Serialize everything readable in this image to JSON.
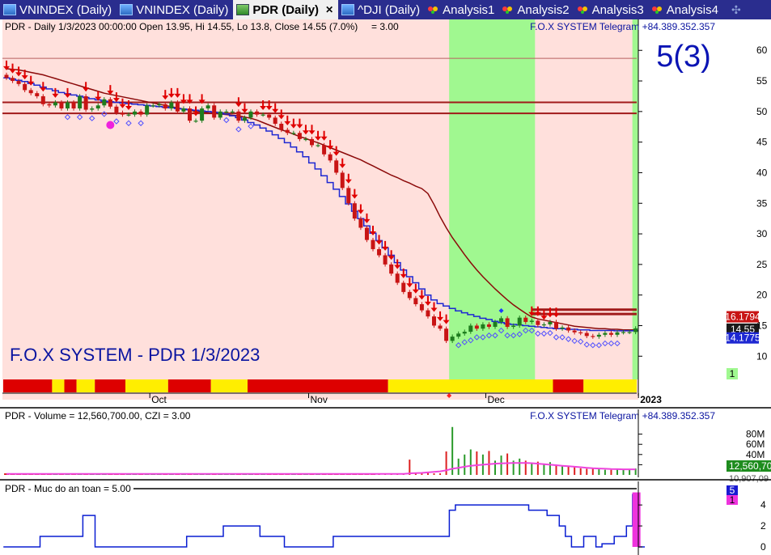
{
  "tabs": [
    {
      "label": "VNINDEX (Daily)",
      "kind": "chart",
      "active": false
    },
    {
      "label": "VNINDEX (Daily)",
      "kind": "chart",
      "active": false
    },
    {
      "label": "PDR (Daily)",
      "kind": "chart",
      "active": true
    },
    {
      "label": "^DJI (Daily)",
      "kind": "chart",
      "active": false
    },
    {
      "label": "Analysis1",
      "kind": "analysis",
      "active": false
    },
    {
      "label": "Analysis2",
      "kind": "analysis",
      "active": false
    },
    {
      "label": "Analysis3",
      "kind": "analysis",
      "active": false
    },
    {
      "label": "Analysis4",
      "kind": "analysis",
      "active": false
    }
  ],
  "tab_close_glyph": "✕",
  "tab_gear_glyph": "✣",
  "colors": {
    "bear_zone": "#ffe0dc",
    "bull_zone": "#a0f890",
    "up_candle": "#1e7d1e",
    "down_candle": "#c81414",
    "ma_fast": "#1e28d2",
    "ma_slow": "#8b0a0a",
    "signal_arrow": "#e00000",
    "volume_ma": "#ee44dd",
    "volume_ma2": "#33dd33",
    "czi": "#d81b1b",
    "safety_line": "#0a1ed2",
    "label_blue": "#0a14a0"
  },
  "chart_data": [
    {
      "type": "candlestick",
      "panel": "price",
      "header": {
        "title": "PDR - Daily 1/3/2023 00:00:00 Open 13.95, Hi 14.55, Lo 13.8, Close 14.55 (7.0%)",
        "extra": "= 3.00",
        "credit": "F.O.X SYSTEM Telegram +84.389.352.357"
      },
      "overlay_label": "F.O.X SYSTEM - PDR 1/3/2023",
      "big_label": "5(3)",
      "y_ticks": [
        10,
        15,
        20,
        25,
        30,
        35,
        40,
        45,
        50,
        55,
        60
      ],
      "ylim": [
        6.2,
        64.0
      ],
      "x_labels": [
        "Oct",
        "Nov",
        "Dec",
        "2023"
      ],
      "x_label_index": [
        24,
        50,
        79,
        104
      ],
      "last_price": "14.55",
      "price_badges": [
        "16.1794",
        "14.55",
        "14.1775"
      ],
      "badge_values": [
        16.18,
        14.55,
        14.18
      ],
      "signal_badge": "1",
      "horizontal_lines": [
        58.7,
        51.5,
        49.7,
        17.6,
        16.9
      ],
      "bull_zones": [
        [
          73,
          86
        ],
        [
          103,
          104
        ]
      ],
      "candles_open": [
        56,
        55.5,
        55,
        54.5,
        53.5,
        53,
        52.5,
        51.2,
        51,
        51.5,
        50.5,
        51.5,
        50.5,
        52.5,
        50.3,
        50.5,
        51,
        52,
        50.8,
        49.8,
        49.5,
        49.5,
        50,
        49.5,
        51,
        51,
        51.2,
        50.5,
        51.5,
        50,
        50.5,
        48.5,
        48.5,
        50.5,
        51,
        49,
        50,
        50,
        50,
        48.5,
        49,
        50,
        49.5,
        49.5,
        49,
        48,
        47,
        46.5,
        46.5,
        45.5,
        45.5,
        44.5,
        44.5,
        43,
        42,
        40,
        37.5,
        35,
        32.5,
        31,
        29,
        27.5,
        26.5,
        25,
        23.5,
        22,
        20.5,
        19.5,
        18.5,
        17.5,
        16.5,
        15,
        14.5,
        12.5,
        13.2,
        13.7,
        14,
        15,
        14.5,
        15.2,
        14.8,
        15.6,
        16.2,
        14.8,
        15,
        16.3,
        15.6,
        15.8,
        15.1,
        15.2,
        15.6,
        14.5,
        14.7,
        14.2,
        13.9,
        13.8,
        13.3,
        13.2,
        13.5,
        13.8,
        13.5,
        13.9,
        13.95,
        13.95
      ],
      "candles_close": [
        55.5,
        55,
        54.5,
        53.5,
        53,
        52.5,
        51.2,
        51,
        51.5,
        50.5,
        51.5,
        50.5,
        52.5,
        50.3,
        50.5,
        51,
        52,
        50.8,
        49.8,
        49.5,
        49.5,
        50,
        49.5,
        51,
        51,
        51.2,
        50.5,
        51.5,
        50,
        50.5,
        48.5,
        48.5,
        50.5,
        51,
        49,
        50,
        50,
        50,
        48.5,
        49,
        50,
        49.5,
        49.5,
        49,
        48,
        47,
        46.5,
        46.5,
        45.5,
        45.5,
        44.5,
        44.5,
        43,
        42,
        40,
        37.5,
        35,
        32.5,
        31,
        29,
        27.5,
        26.5,
        25,
        23.5,
        22,
        20.5,
        19.5,
        18.5,
        17.5,
        16.5,
        15,
        14.5,
        12.5,
        13.2,
        13.7,
        14,
        15,
        14.5,
        15.2,
        14.8,
        15.6,
        16.2,
        14.8,
        15,
        16.3,
        15.6,
        15.8,
        15.1,
        15.2,
        15.6,
        14.5,
        14.7,
        14.2,
        13.9,
        13.8,
        13.3,
        13.2,
        13.5,
        13.8,
        13.5,
        13.9,
        13.95,
        13.95,
        14.55
      ],
      "ma_fast": [
        55.5,
        55.3,
        55.1,
        54.9,
        54.6,
        54.3,
        54,
        53.7,
        53.4,
        53.1,
        52.9,
        52.7,
        52.5,
        52.3,
        52.1,
        51.9,
        51.7,
        51.6,
        51.5,
        51.4,
        51.3,
        51.2,
        51.1,
        51,
        50.9,
        50.8,
        50.7,
        50.6,
        50.5,
        50.4,
        50.3,
        50.2,
        50.1,
        50,
        49.9,
        49.8,
        49.6,
        49.3,
        49,
        48.6,
        48.2,
        47.8,
        47.3,
        46.8,
        46.2,
        45.6,
        44.9,
        44.2,
        43.4,
        42.6,
        41.6,
        40.6,
        39.5,
        38.4,
        37.3,
        36.1,
        34.9,
        33.7,
        32.5,
        31.3,
        30.1,
        28.9,
        27.7,
        26.5,
        25.3,
        24.1,
        23,
        22,
        21,
        20,
        19.2,
        18.6,
        18.2,
        17.8,
        17.4,
        17.1,
        16.8,
        16.5,
        16.2,
        16,
        15.7,
        15.5,
        15.3,
        15.2,
        15.1,
        15,
        14.9,
        14.8,
        14.7,
        14.6,
        14.5,
        14.5,
        14.4,
        14.4,
        14.3,
        14.3,
        14.2,
        14.2,
        14.2,
        14.2,
        14.15,
        14.15,
        14.15,
        14.18
      ],
      "ma_slow": [
        57,
        56.9,
        56.8,
        56.6,
        56.4,
        56.2,
        56,
        55.7,
        55.4,
        55.1,
        54.8,
        54.5,
        54.2,
        53.9,
        53.6,
        53.3,
        53,
        52.8,
        52.6,
        52.4,
        52.2,
        52,
        51.8,
        51.6,
        51.4,
        51.2,
        51,
        50.8,
        50.6,
        50.4,
        50.2,
        50,
        49.9,
        49.8,
        49.7,
        49.6,
        49.5,
        49.4,
        49.3,
        49.1,
        48.9,
        48.6,
        48.2,
        47.8,
        47.4,
        47,
        46.7,
        46.3,
        45.9,
        45.6,
        45.2,
        44.9,
        44.5,
        44.1,
        43.7,
        43.3,
        42.9,
        42.5,
        42.1,
        41.6,
        41.1,
        40.6,
        40.1,
        39.6,
        39.2,
        38.7,
        38.3,
        37.8,
        37.4,
        36.6,
        34.8,
        32.8,
        31,
        29.4,
        28,
        26.6,
        25.3,
        24.1,
        23,
        22,
        21,
        20.1,
        19.2,
        18.4,
        17.7,
        17,
        16.4,
        16.1,
        15.9,
        15.7,
        15.5,
        15.3,
        15.1,
        14.9,
        14.8,
        14.7,
        14.6,
        14.5,
        14.5,
        14.4,
        14.4,
        14.3,
        14.3,
        14.3
      ],
      "sell_arrows": [
        0,
        1,
        2,
        3,
        4,
        6,
        8,
        10,
        13,
        15,
        17,
        18,
        19,
        20,
        26,
        27,
        28,
        29,
        30,
        31,
        32,
        38,
        39,
        42,
        43,
        44,
        45,
        46,
        47,
        48,
        49,
        50,
        51,
        52,
        53,
        54,
        55,
        56,
        57,
        58,
        59,
        60,
        61,
        62,
        63,
        64,
        65,
        66,
        67,
        68,
        69,
        70,
        71,
        72,
        86,
        87,
        88,
        89,
        90
      ]
    },
    {
      "type": "bar",
      "panel": "volume",
      "header": {
        "name": "PDR - Volume = 12,560,700.00, CZI = 3.00",
        "credit": "F.O.X SYSTEM Telegram +84.389.352.357"
      },
      "y_ticks": [
        "80M",
        "60M",
        "40M",
        "20M"
      ],
      "y_tick_values": [
        80,
        60,
        40,
        20
      ],
      "ylim": [
        0,
        100
      ],
      "last_label": "12,560,70",
      "ma_label": "10,907,09",
      "volume_m": [
        3,
        3,
        3,
        2,
        3,
        3,
        3,
        2,
        2,
        3,
        3,
        2,
        3,
        3,
        2,
        2,
        3,
        3,
        3,
        2,
        2,
        2,
        3,
        2,
        3,
        2,
        3,
        2,
        3,
        3,
        3,
        2,
        2,
        3,
        3,
        2,
        3,
        3,
        3,
        2,
        3,
        3,
        3,
        2,
        3,
        3,
        3,
        3,
        3,
        3,
        3,
        3,
        3,
        3,
        3,
        3,
        3,
        3,
        3,
        3,
        3,
        3,
        3,
        3,
        3,
        3,
        30,
        3,
        3,
        4,
        3,
        3,
        46,
        94,
        32,
        40,
        50,
        46,
        40,
        47,
        28,
        38,
        42,
        28,
        32,
        28,
        22,
        26,
        20,
        25,
        20,
        18,
        16,
        15,
        13,
        12,
        12,
        11,
        10,
        10,
        11,
        11,
        10,
        12.56
      ],
      "volume_ma_m": [
        2,
        2,
        2,
        2,
        2,
        2,
        2,
        2,
        2,
        2,
        2,
        2,
        2,
        2,
        2,
        2,
        2,
        2,
        2,
        2,
        2,
        2,
        2,
        2,
        2,
        2,
        2,
        2,
        2,
        2,
        2,
        2,
        2,
        2,
        2,
        2,
        2,
        2,
        2,
        2,
        2,
        2,
        2,
        2,
        2,
        2,
        2,
        2,
        2,
        2,
        2,
        2,
        2,
        2,
        2,
        2,
        2,
        2,
        2,
        2,
        2,
        2,
        2,
        2,
        2,
        2,
        3,
        3.5,
        4,
        5,
        6,
        7,
        9,
        12,
        14,
        16,
        18,
        19,
        20,
        21,
        22,
        22.5,
        23,
        23.5,
        23.5,
        23.3,
        23,
        22,
        21,
        20,
        19,
        18,
        17,
        16,
        15,
        14,
        13,
        12.5,
        12,
        11.5,
        11.2,
        11,
        11,
        10.9
      ]
    },
    {
      "type": "line",
      "panel": "safety",
      "header": {
        "name": "PDR - Muc do an toan = 5.00"
      },
      "y_ticks": [
        "4",
        "2",
        "0"
      ],
      "y_tick_values": [
        4,
        2,
        0
      ],
      "ylim": [
        0,
        5.4
      ],
      "current_badge": "5",
      "sub_badge": "1",
      "levels": [
        0,
        0,
        0,
        0,
        0,
        0,
        1,
        1,
        1,
        1,
        1,
        1,
        1,
        3,
        3,
        0,
        0,
        0,
        0,
        0,
        0,
        0,
        0,
        0,
        0,
        0,
        0,
        0,
        0,
        0,
        1,
        1,
        1,
        1,
        1,
        1,
        2,
        2,
        2,
        2,
        2,
        2,
        1,
        1,
        1,
        1,
        0,
        0,
        0,
        0,
        0,
        0,
        0,
        0,
        1,
        1,
        1,
        1,
        1,
        1,
        1,
        1,
        1,
        1,
        1,
        1,
        1,
        1,
        1,
        1,
        1,
        1,
        1,
        1,
        1,
        1,
        1,
        1,
        1,
        1,
        1,
        1,
        1,
        1,
        1,
        1,
        1,
        1,
        1,
        1,
        1,
        1,
        1,
        0,
        0,
        0,
        0,
        0,
        0,
        0,
        0,
        0,
        0,
        0,
        0
      ],
      "levels_late": [
        0,
        0,
        0,
        0,
        0,
        0,
        0,
        0,
        0,
        0,
        0,
        0,
        0,
        0,
        0,
        0,
        0,
        0,
        0,
        0,
        0,
        0,
        0,
        0,
        0,
        0,
        0,
        0,
        0,
        0,
        0,
        0,
        0,
        0,
        0,
        0,
        0,
        0,
        0,
        0,
        0,
        0,
        0,
        0,
        0,
        0,
        0,
        0,
        0,
        0,
        0,
        0,
        0,
        0,
        0,
        0,
        0,
        0,
        0,
        0,
        0,
        0,
        0,
        0,
        0,
        0,
        0,
        0,
        0,
        0,
        0,
        0,
        0,
        3.5,
        4,
        4,
        4,
        4,
        4,
        4,
        4,
        4,
        4,
        4,
        4,
        4,
        3.5,
        3.5,
        3.5,
        3,
        3,
        2,
        0,
        0,
        0,
        1,
        1,
        0,
        0.3,
        0.3,
        1,
        1,
        2,
        5
      ]
    }
  ]
}
